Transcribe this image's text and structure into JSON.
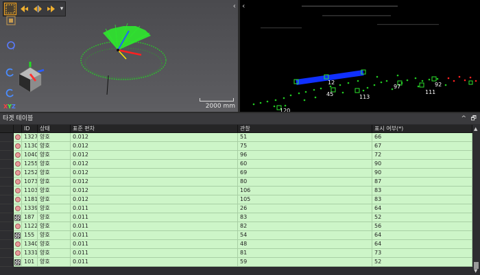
{
  "toolbar": {
    "buttons": [
      "select-rect-icon",
      "move-left-icon",
      "move-split-icon",
      "move-right-icon",
      "dropdown-icon"
    ],
    "active": "select-rect-icon"
  },
  "viewport_left": {
    "scale_label": "2000 mm",
    "axis_label_x": "X",
    "axis_label_y": "Y",
    "axis_label_z": "Z"
  },
  "viewport_right": {
    "point_labels": [
      "12",
      "45",
      "113",
      "97",
      "111",
      "92",
      "120"
    ]
  },
  "panel": {
    "title": "타겟 테이블",
    "collapse_glyph": "^",
    "restore_glyph": "🗗"
  },
  "table": {
    "headers": [
      "",
      "",
      "ID",
      "상태",
      "표준 편차",
      "관찰",
      "표시 여부(*)"
    ],
    "rows": [
      {
        "icon": "dot",
        "id": "1327",
        "status": "양호",
        "std": "0.012",
        "obs": "51",
        "vis": "66"
      },
      {
        "icon": "dot",
        "id": "1130",
        "status": "양호",
        "std": "0.012",
        "obs": "75",
        "vis": "67"
      },
      {
        "icon": "dot",
        "id": "1040",
        "status": "양호",
        "std": "0.012",
        "obs": "96",
        "vis": "72"
      },
      {
        "icon": "dot",
        "id": "1255",
        "status": "양호",
        "std": "0.012",
        "obs": "60",
        "vis": "90"
      },
      {
        "icon": "dot",
        "id": "1252",
        "status": "양호",
        "std": "0.012",
        "obs": "69",
        "vis": "90"
      },
      {
        "icon": "dot",
        "id": "1073",
        "status": "양호",
        "std": "0.012",
        "obs": "80",
        "vis": "87"
      },
      {
        "icon": "dot",
        "id": "1103",
        "status": "양호",
        "std": "0.012",
        "obs": "106",
        "vis": "83"
      },
      {
        "icon": "dot",
        "id": "1181",
        "status": "양호",
        "std": "0.012",
        "obs": "105",
        "vis": "83"
      },
      {
        "icon": "dot",
        "id": "1339",
        "status": "양호",
        "std": "0.011",
        "obs": "26",
        "vis": "64"
      },
      {
        "icon": "target",
        "id": "187",
        "status": "양호",
        "std": "0.011",
        "obs": "83",
        "vis": "52"
      },
      {
        "icon": "dot",
        "id": "1122",
        "status": "양호",
        "std": "0.011",
        "obs": "82",
        "vis": "56"
      },
      {
        "icon": "target",
        "id": "155",
        "status": "양호",
        "std": "0.011",
        "obs": "54",
        "vis": "64"
      },
      {
        "icon": "dot",
        "id": "1340",
        "status": "양호",
        "std": "0.011",
        "obs": "48",
        "vis": "64"
      },
      {
        "icon": "dot",
        "id": "1331",
        "status": "양호",
        "std": "0.011",
        "obs": "81",
        "vis": "73"
      },
      {
        "icon": "target",
        "id": "101",
        "status": "양호",
        "std": "0.011",
        "obs": "59",
        "vis": "52"
      }
    ]
  },
  "colors": {
    "row_bg": "#cdf5c8",
    "viewport_bg": "#4f4f53",
    "points": "#22cc22",
    "segment": "#1030ff",
    "red_points": "#ff2020"
  }
}
